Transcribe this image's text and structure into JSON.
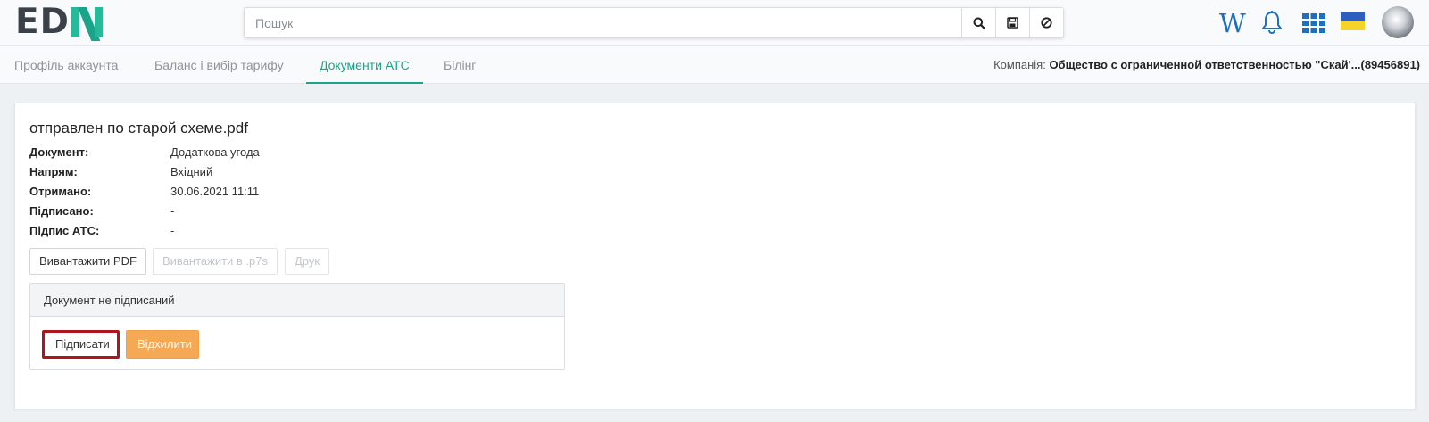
{
  "header": {
    "logo_left": "ED",
    "search": {
      "placeholder": "Пошук"
    },
    "wiki_glyph": "W"
  },
  "tabs": [
    {
      "label": "Профіль аккаунта",
      "active": false
    },
    {
      "label": "Баланс і вибір тарифу",
      "active": false
    },
    {
      "label": "Документи АТС",
      "active": true
    },
    {
      "label": "Білінг",
      "active": false
    }
  ],
  "company": {
    "label": "Компанія:",
    "name": "Общество с ограниченной ответственностью \"Скай'...(89456891)"
  },
  "document": {
    "title": "отправлен по старой схеме.pdf",
    "fields": [
      {
        "key": "Документ:",
        "value": "Додаткова угода"
      },
      {
        "key": "Напрям:",
        "value": "Вхідний"
      },
      {
        "key": "Отримано:",
        "value": "30.06.2021 11:11"
      },
      {
        "key": "Підписано:",
        "value": "-"
      },
      {
        "key": "Підпис АТС:",
        "value": "-"
      }
    ]
  },
  "actions": {
    "download_pdf": "Вивантажити PDF",
    "download_p7s": "Вивантажити в .p7s",
    "print": "Друк"
  },
  "signature_panel": {
    "status": "Документ не підписаний",
    "sign_label": "Підписати",
    "reject_label": "Відхилити"
  },
  "colors": {
    "accent": "#1da38a",
    "logo_green": "#27b99a",
    "reject": "#f5a955",
    "highlight": "#b0141c"
  },
  "icons": [
    "search-icon",
    "save-icon",
    "clear-icon",
    "wiki-icon",
    "bell-icon",
    "apps-grid-icon",
    "ukraine-flag-icon",
    "user-avatar"
  ]
}
